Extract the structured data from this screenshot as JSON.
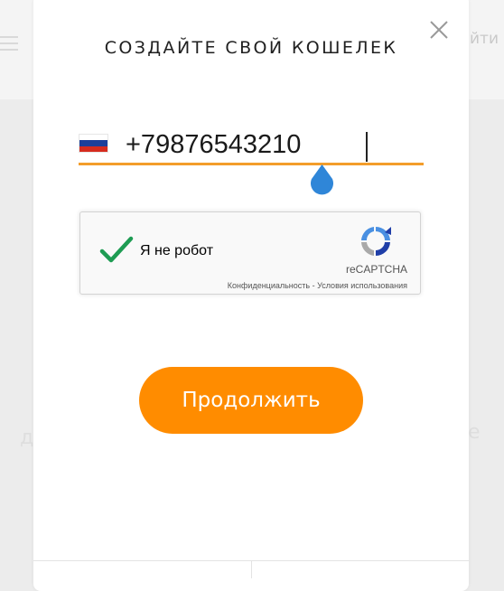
{
  "background": {
    "login_text": "йти",
    "left_fragment": "д",
    "right_fragment": "е"
  },
  "modal": {
    "title": "СОЗДАЙТЕ СВОЙ КОШЕЛЕК",
    "close_icon": "close-icon",
    "phone": {
      "country_flag": "russia-flag-icon",
      "value": "+79876543210",
      "underline_color": "#f39d2b"
    },
    "captcha": {
      "checked": true,
      "label": "Я не робот",
      "brand": "reCAPTCHA",
      "privacy_link": "Конфиденциальность",
      "separator": " - ",
      "terms_link": "Условия использования"
    },
    "continue_label": "Продолжить",
    "accent_color": "#ff8c00"
  }
}
